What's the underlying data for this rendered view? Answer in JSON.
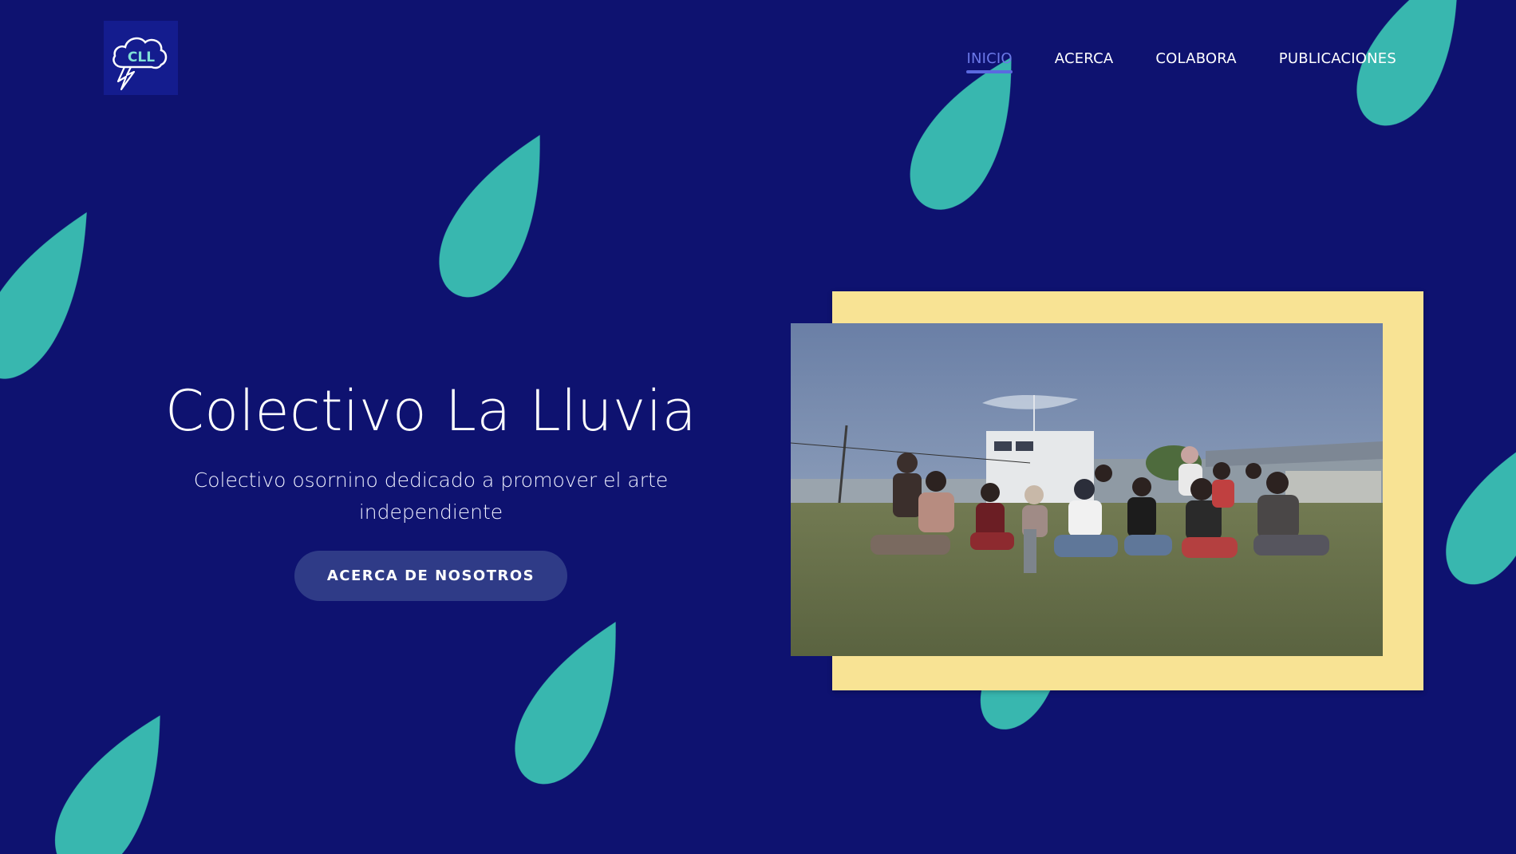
{
  "brand": {
    "logo_text": "CLL",
    "logo_icon": "cloud-lightning-icon"
  },
  "nav": {
    "items": [
      {
        "label": "INICIO",
        "active": true
      },
      {
        "label": "ACERCA",
        "active": false
      },
      {
        "label": "COLABORA",
        "active": false
      },
      {
        "label": "PUBLICACIONES",
        "active": false
      }
    ]
  },
  "hero": {
    "title": "Colectivo La Lluvia",
    "subtitle": "Colectivo osornino dedicado a promover el arte independiente",
    "cta_label": "ACERCA DE NOSOTROS"
  },
  "colors": {
    "background": "#0e1270",
    "raindrop": "#3cc7b5",
    "frame": "#f8e394",
    "nav_active": "#6b78e8",
    "button": "#2f3b87"
  },
  "media": {
    "photo_icon": "group-photo"
  }
}
